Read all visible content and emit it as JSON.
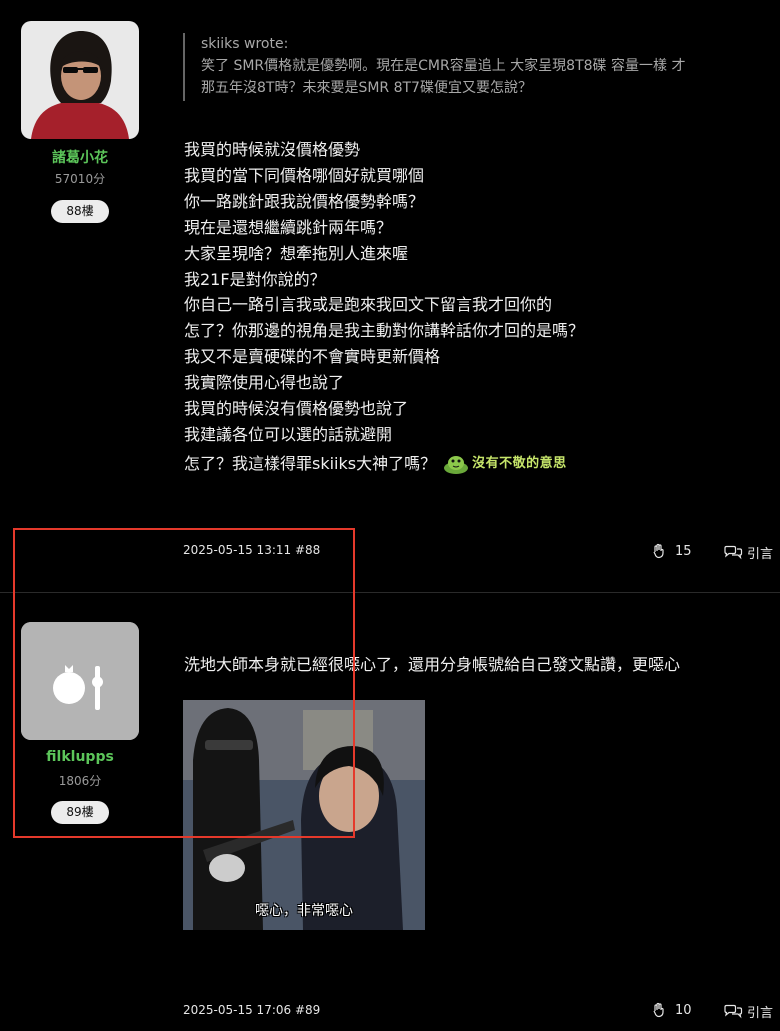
{
  "posts": [
    {
      "author": "諸葛小花",
      "points": "57010分",
      "floor": "88樓",
      "quote": {
        "header": "skiiks wrote:",
        "lines": [
          "笑了 SMR價格就是優勢啊。現在是CMR容量追上 大家呈現8T8碟 容量一樣 才",
          "那五年沒8T時？未來要是SMR 8T7碟便宜又要怎說？"
        ]
      },
      "body": [
        "我買的時候就沒價格優勢",
        "我買的當下同價格哪個好就買哪個",
        "你一路跳針跟我說價格優勢幹嗎？",
        "現在是還想繼續跳針兩年嗎？",
        "大家呈現啥？想牽拖別人進來喔",
        "我21F是對你說的？",
        "你自己一路引言我或是跑來我回文下留言我才回你的",
        "怎了？你那邊的視角是我主動對你講幹話你才回的是嗎？",
        "我又不是賣硬碟的不會實時更新價格",
        "我實際使用心得也說了",
        "我買的時候沒有價格優勢也說了",
        "我建議各位可以選的話就避開",
        "怎了？我這樣得罪skiiks大神了嗎？"
      ],
      "sticker_text": "沒有不敬的意思",
      "meta": "2025-05-15 13:11 #88",
      "likes": "15",
      "quote_label": "引言"
    },
    {
      "author": "filklupрs",
      "points": "1806分",
      "floor": "89樓",
      "text": "洗地大師本身就已經很噁心了，還用分身帳號給自己發文點讚，更噁心",
      "image_caption": "噁心，非常噁心",
      "meta": "2025-05-15 17:06 #89",
      "likes": "10",
      "quote_label": "引言"
    }
  ],
  "colors": {
    "background": "#000000",
    "author": "#5cc55a",
    "highlight": "#e5392b"
  },
  "icons": [
    "clap-icon",
    "chat-bubble-icon",
    "default-avatar-icon",
    "sticker-icon"
  ]
}
